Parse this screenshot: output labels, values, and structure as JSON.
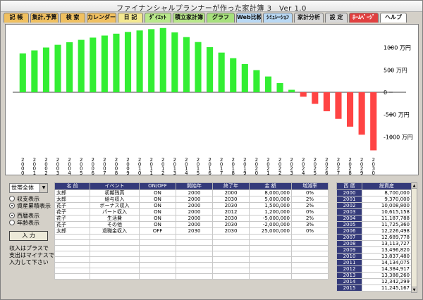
{
  "window": {
    "title": "ファイナンシャルプランナーが作った家計簿 3　Ver 1.0"
  },
  "tabs": [
    {
      "label": "記 帳",
      "color": "#f0c060"
    },
    {
      "label": "集計,予算",
      "color": "#f0c060"
    },
    {
      "label": "検 索",
      "color": "#f0c060"
    },
    {
      "label": "カレンダー",
      "color": "#f0c060"
    },
    {
      "label": "日 記",
      "color": "#f4e890"
    },
    {
      "label": "ﾀﾞｲｴｯﾄ",
      "color": "#b8e88a"
    },
    {
      "label": "積立家計簿",
      "color": "#b8e88a"
    },
    {
      "label": "グラフ",
      "color": "#a6e07c"
    },
    {
      "label": "Web比較",
      "color": "#b8d8f4"
    },
    {
      "label": "ｼﾐｭﾚｰｼｮﾝ",
      "color": "#b8d8f4"
    },
    {
      "label": "家計分析",
      "color": "#d8d8d8"
    },
    {
      "label": "設 定",
      "color": "#d8d8d8"
    },
    {
      "label": "ﾎｰﾑﾍﾟｰｼﾞ",
      "color": "#e04040"
    },
    {
      "label": "ヘルプ",
      "color": "#ffffff"
    }
  ],
  "chart_data": {
    "type": "bar",
    "unit": "万円",
    "categories": [
      "2000",
      "2001",
      "2002",
      "2003",
      "2004",
      "2005",
      "2006",
      "2007",
      "2008",
      "2009",
      "2010",
      "2011",
      "2012",
      "2013",
      "2014",
      "2015",
      "2016",
      "2017",
      "2018",
      "2019",
      "2020",
      "2021",
      "2022",
      "2023",
      "2024",
      "2025",
      "2026",
      "2027",
      "2028",
      "2029",
      "2030"
    ],
    "values": [
      870,
      937,
      1001,
      1062,
      1119,
      1173,
      1223,
      1269,
      1311,
      1350,
      1383,
      1413,
      1438,
      1339,
      1234,
      1124,
      1009,
      888,
      763,
      631,
      495,
      353,
      206,
      55,
      -100,
      -260,
      -425,
      -595,
      -770,
      -950,
      -1300
    ],
    "y_ticks": [
      {
        "value": 1000,
        "label": "1000 万円"
      },
      {
        "value": 500,
        "label": "500 万円"
      },
      {
        "value": 0,
        "label": "0"
      },
      {
        "value": -500,
        "label": "-500 万円"
      },
      {
        "value": -1000,
        "label": "-1000 万円"
      }
    ],
    "ylim": [
      -1450,
      1450
    ],
    "positive_color": "#33ee33",
    "negative_color": "#ff4444"
  },
  "controls": {
    "scope_select": "世帯全体",
    "radio_balance": "収支表示",
    "radio_asset": "資産累積表示",
    "radio_asset_checked": true,
    "radio_western": "西暦表示",
    "radio_western_checked": true,
    "radio_age": "年齢表示",
    "enter_button": "入 力",
    "note_line1": "収入はプラスで",
    "note_line2": "支出はマイナスで",
    "note_line3": "入力して下さい"
  },
  "events": {
    "headers": [
      "名 前",
      "イベント",
      "ON/OFF",
      "開始年",
      "終了年",
      "金 額",
      "増減率"
    ],
    "rows": [
      [
        "太郎",
        "初期残高",
        "ON",
        "2000",
        "2000",
        "8,000,000",
        "0%"
      ],
      [
        "太郎",
        "給与収入",
        "ON",
        "2000",
        "2030",
        "5,000,000",
        "2%"
      ],
      [
        "花子",
        "ボーナス収入",
        "ON",
        "2000",
        "2030",
        "1,500,000",
        "2%"
      ],
      [
        "花子",
        "パート収入",
        "ON",
        "2000",
        "2012",
        "1,200,000",
        "0%"
      ],
      [
        "花子",
        "生活費",
        "ON",
        "2000",
        "2030",
        "-5,000,000",
        "2%"
      ],
      [
        "花子",
        "その他",
        "ON",
        "2000",
        "2030",
        "-2,000,000",
        "3%"
      ],
      [
        "太郎",
        "退職金収入",
        "OFF",
        "2030",
        "2030",
        "25,000,000",
        "0%"
      ],
      [
        "",
        "",
        "",
        "",
        "",
        "",
        ""
      ],
      [
        "",
        "",
        "",
        "",
        "",
        "",
        ""
      ],
      [
        "",
        "",
        "",
        "",
        "",
        "",
        ""
      ],
      [
        "",
        "",
        "",
        "",
        "",
        "",
        ""
      ],
      [
        "",
        "",
        "",
        "",
        "",
        "",
        ""
      ],
      [
        "",
        "",
        "",
        "",
        "",
        "",
        ""
      ],
      [
        "",
        "",
        "",
        "",
        "",
        "",
        ""
      ],
      [
        "",
        "",
        "",
        "",
        "",
        "",
        ""
      ]
    ]
  },
  "years": {
    "headers": [
      "西 暦",
      "総資産"
    ],
    "rows": [
      [
        "2000",
        "8,700,000"
      ],
      [
        "2001",
        "9,370,000"
      ],
      [
        "2002",
        "10,008,800"
      ],
      [
        "2003",
        "10,615,158"
      ],
      [
        "2004",
        "11,187,788"
      ],
      [
        "2005",
        "11,725,360"
      ],
      [
        "2006",
        "12,226,498"
      ],
      [
        "2007",
        "12,689,778"
      ],
      [
        "2008",
        "13,113,727"
      ],
      [
        "2009",
        "13,496,820"
      ],
      [
        "2010",
        "13,837,480"
      ],
      [
        "2011",
        "14,134,075"
      ],
      [
        "2012",
        "14,384,917"
      ],
      [
        "2013",
        "13,388,260"
      ],
      [
        "2014",
        "12,342,299"
      ],
      [
        "2015",
        "11,245,167"
      ]
    ]
  },
  "scroll_up_icon": "▲",
  "scroll_down_icon": "▼"
}
